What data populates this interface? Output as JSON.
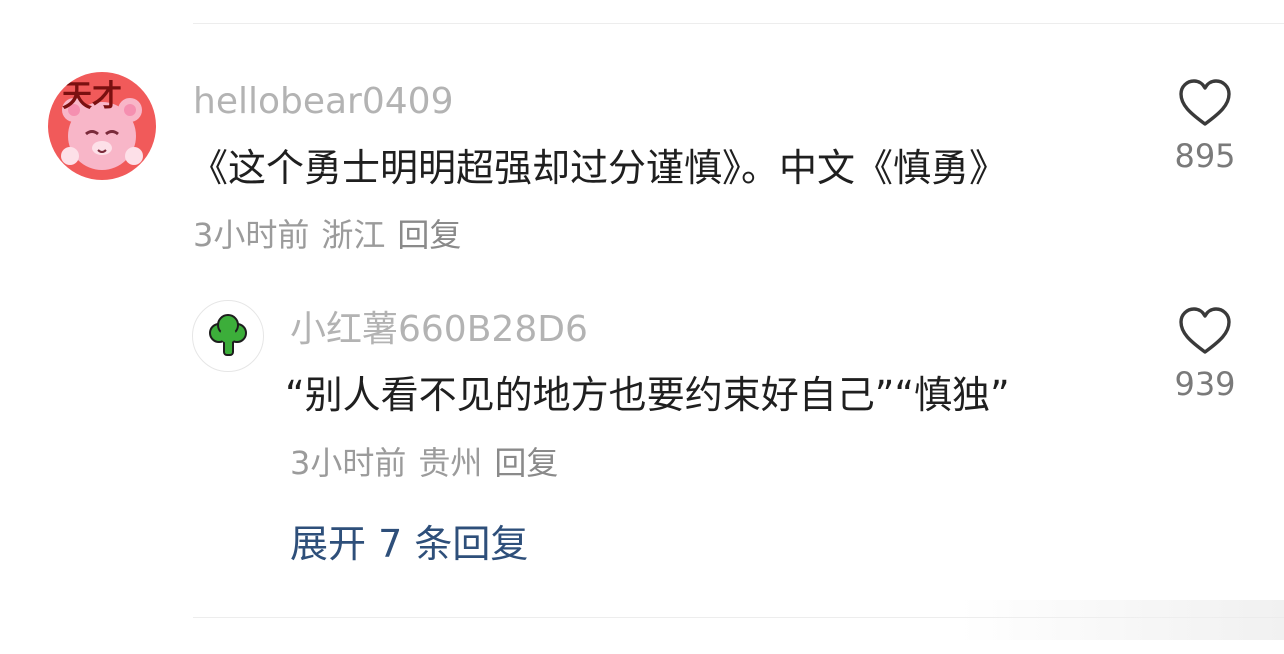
{
  "comment": {
    "username": "hellobear0409",
    "text": "《这个勇士明明超强却过分谨慎》。中文《慎勇》",
    "time": "3小时前",
    "location": "浙江",
    "reply_label": "回复",
    "like_count": "895",
    "avatar_text": "天才"
  },
  "reply": {
    "username": "小红薯660B28D6",
    "text": "“别人看不见的地方也要约束好自己”“慎独”",
    "time": "3小时前",
    "location": "贵州",
    "reply_label": "回复",
    "like_count": "939"
  },
  "expand_label": "展开 7 条回复",
  "colors": {
    "username": "#b3b3b3",
    "text": "#1f1f1f",
    "meta": "#9b9b9b",
    "expand_link": "#2e4f7a",
    "avatar_bg": "#f15a5a",
    "broccoli": "#3cae3a"
  },
  "icons": {
    "like": "heart-outline-icon",
    "reply_avatar": "broccoli-icon"
  }
}
